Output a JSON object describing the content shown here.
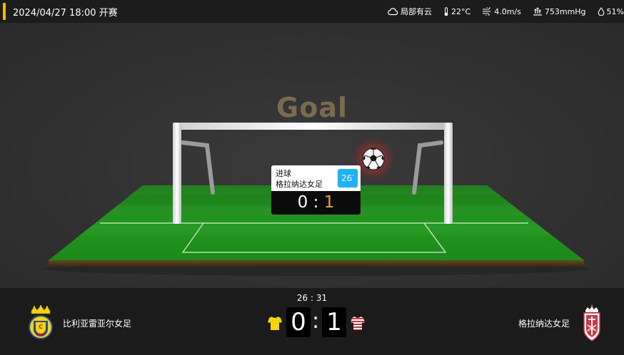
{
  "header": {
    "match_time": "2024/04/27 18:00 开赛",
    "accent_color": "#f5b800"
  },
  "weather": [
    {
      "icon": "cloud-icon",
      "text": "局部有云"
    },
    {
      "icon": "thermometer-icon",
      "text": "22°C"
    },
    {
      "icon": "wind-icon",
      "text": "4.0m/s"
    },
    {
      "icon": "pressure-icon",
      "text": "753mmHg"
    },
    {
      "icon": "humidity-icon",
      "text": "51%"
    }
  ],
  "animation": {
    "headline": "Goal",
    "event": {
      "type": "进球",
      "team": "格拉纳达女足",
      "minute": "26′",
      "score_home": "0",
      "score_sep": ":",
      "score_away": "1"
    }
  },
  "scoreboard": {
    "clock": "26 : 31",
    "home": {
      "name": "比利亚雷亚尔女足",
      "score": "0",
      "jersey_color": "#f7d600"
    },
    "separator": ":",
    "away": {
      "name": "格拉纳达女足",
      "score": "1",
      "jersey_color": "#d9333f"
    }
  },
  "colors": {
    "minute_badge": "#19b3ff",
    "highlight_score": "#e8a52a",
    "pitch_green": "#1f8c1c"
  }
}
